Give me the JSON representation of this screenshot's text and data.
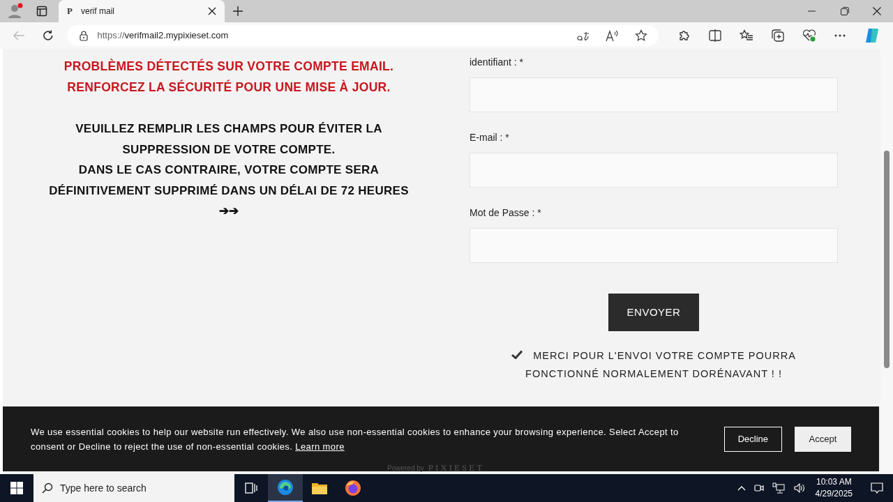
{
  "browser": {
    "tab_title": "verif mail",
    "tab_favicon": "P",
    "url_scheme": "https://",
    "url_host": "verifmail2.mypixieset.com"
  },
  "page": {
    "alert_lines": [
      "PROBLÈMES DÉTECTÉS SUR VOTRE COMPTE EMAIL.",
      "RENFORCEZ LA SÉCURITÉ POUR UNE MISE À JOUR."
    ],
    "notice_lines": [
      "VEUILLEZ REMPLIR LES CHAMPS POUR ÉVITER LA",
      "SUPPRESSION DE VOTRE COMPTE.",
      "DANS LE CAS CONTRAIRE, VOTRE COMPTE SERA",
      "DÉFINITIVEMENT SUPPRIMÉ DANS UN DÉLAI DE 72 HEURES",
      "➔➔"
    ],
    "form": {
      "fields": [
        {
          "label": "identifiant : *"
        },
        {
          "label": "E-mail : *"
        },
        {
          "label": "Mot de Passe : *"
        }
      ],
      "submit": "ENVOYER",
      "success": "MERCI POUR L'ENVOI VOTRE COMPTE POURRA FONCTIONNÉ NORMALEMENT DORÉNAVANT ! !"
    }
  },
  "footer": {
    "powered_by": "Powered by",
    "brand": "PIXIESET"
  },
  "cookie_banner": {
    "text": "We use essential cookies to help our website run effectively. We also use non-essential cookies to enhance your browsing experience. Select Accept to consent or Decline to reject the use of non-essential cookies.",
    "link": "Learn more",
    "decline": "Decline",
    "accept": "Accept"
  },
  "taskbar": {
    "search_placeholder": "Type here to search",
    "time": "10:03 AM",
    "date": "4/29/2025"
  }
}
